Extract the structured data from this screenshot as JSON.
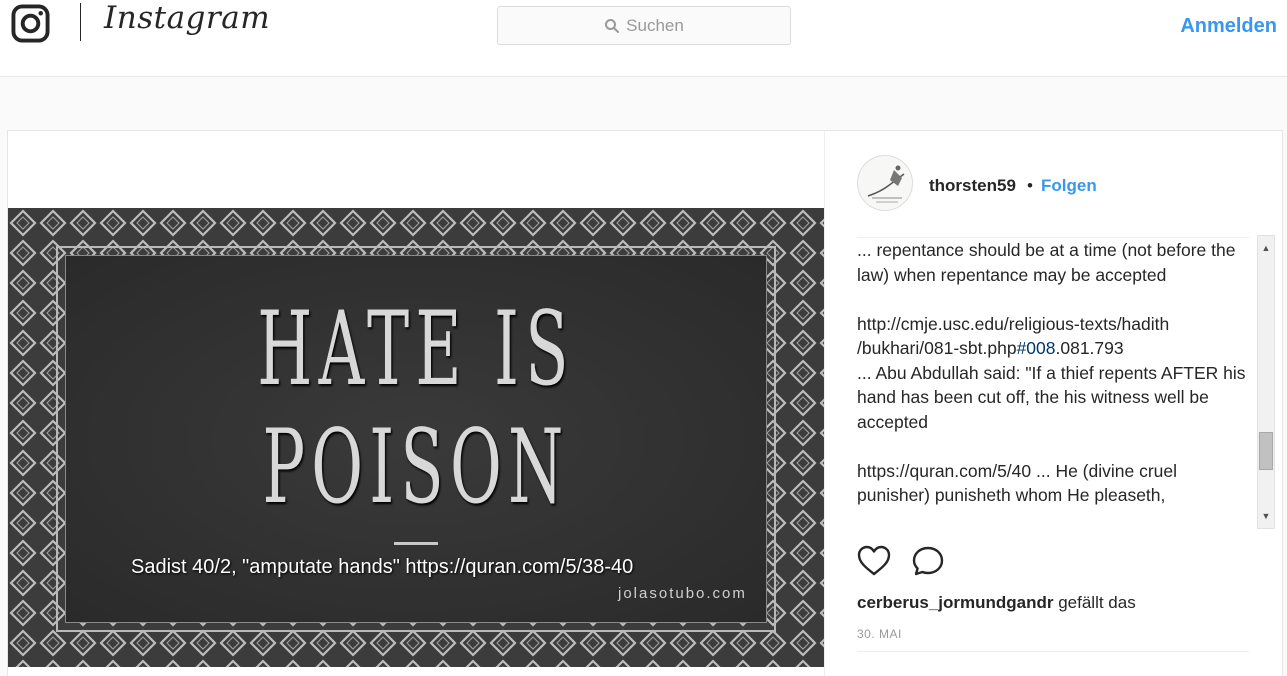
{
  "header": {
    "brand": "Instagram",
    "search_placeholder": "Suchen",
    "login_label": "Anmelden"
  },
  "post": {
    "image": {
      "line1": "HATE IS",
      "line2": "POISON",
      "overlay_caption": "Sadist 40/2, \"amputate hands\" https://quran.com/5/38-40",
      "watermark": "jolasotubo.com"
    },
    "author": {
      "username": "thorsten59",
      "separator": "•",
      "follow_label": "Folgen"
    },
    "comments": [
      {
        "text": "... repentance should be at a time (not before the law) when repentance may be accepted"
      },
      {
        "before": "http://cmje.usc.edu/religious-texts/hadith /bukhari/081-sbt.php",
        "hashtag": "#008",
        "after": ".081.793\n... Abu Abdullah said: \"If a thief repents AFTER his hand has been cut off, the his witness well be accepted"
      },
      {
        "text": "https://quran.com/5/40 ... He (divine cruel punisher) punisheth whom He pleaseth,"
      }
    ],
    "likes": {
      "user": "cerberus_jormundgandr",
      "suffix": " gefällt das"
    },
    "date": "30. MAI"
  },
  "colors": {
    "accent": "#3897f0",
    "hashtag": "#003569",
    "text": "#262626",
    "muted": "#999999"
  }
}
